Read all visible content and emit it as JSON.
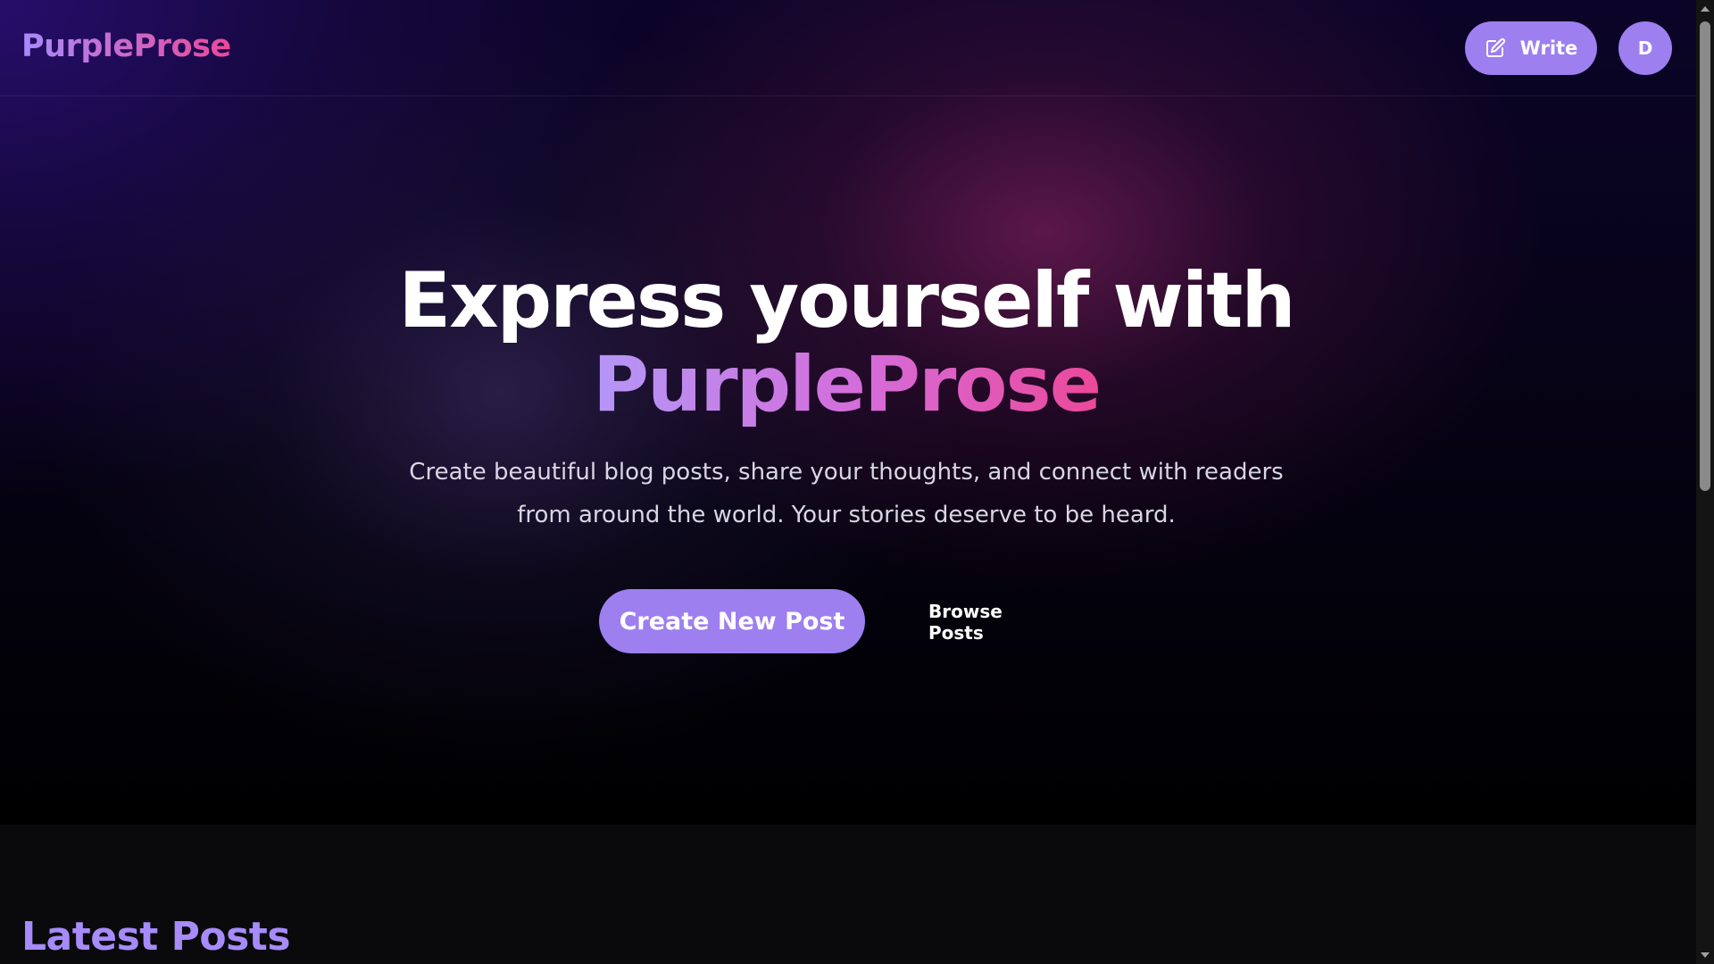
{
  "header": {
    "logo": "PurpleProse",
    "write_button_label": "Write",
    "write_icon": "edit-icon",
    "avatar_initial": "D"
  },
  "hero": {
    "title_line1": "Express yourself with",
    "title_line2": "PurpleProse",
    "subtitle": "Create beautiful blog posts, share your thoughts, and connect with readers from around the world. Your stories deserve to be heard.",
    "primary_button": "Create New Post",
    "secondary_button": "Browse Posts"
  },
  "latest": {
    "title": "Latest Posts"
  },
  "colors": {
    "accent": "#9d7ff0",
    "gradient_start": "#a78bfa",
    "gradient_end": "#ec4899",
    "background": "#000000",
    "section_background": "#0a0a0c"
  },
  "scrollbar": {
    "up_icon": "scroll-up-arrow-icon",
    "down_icon": "scroll-down-arrow-icon"
  }
}
